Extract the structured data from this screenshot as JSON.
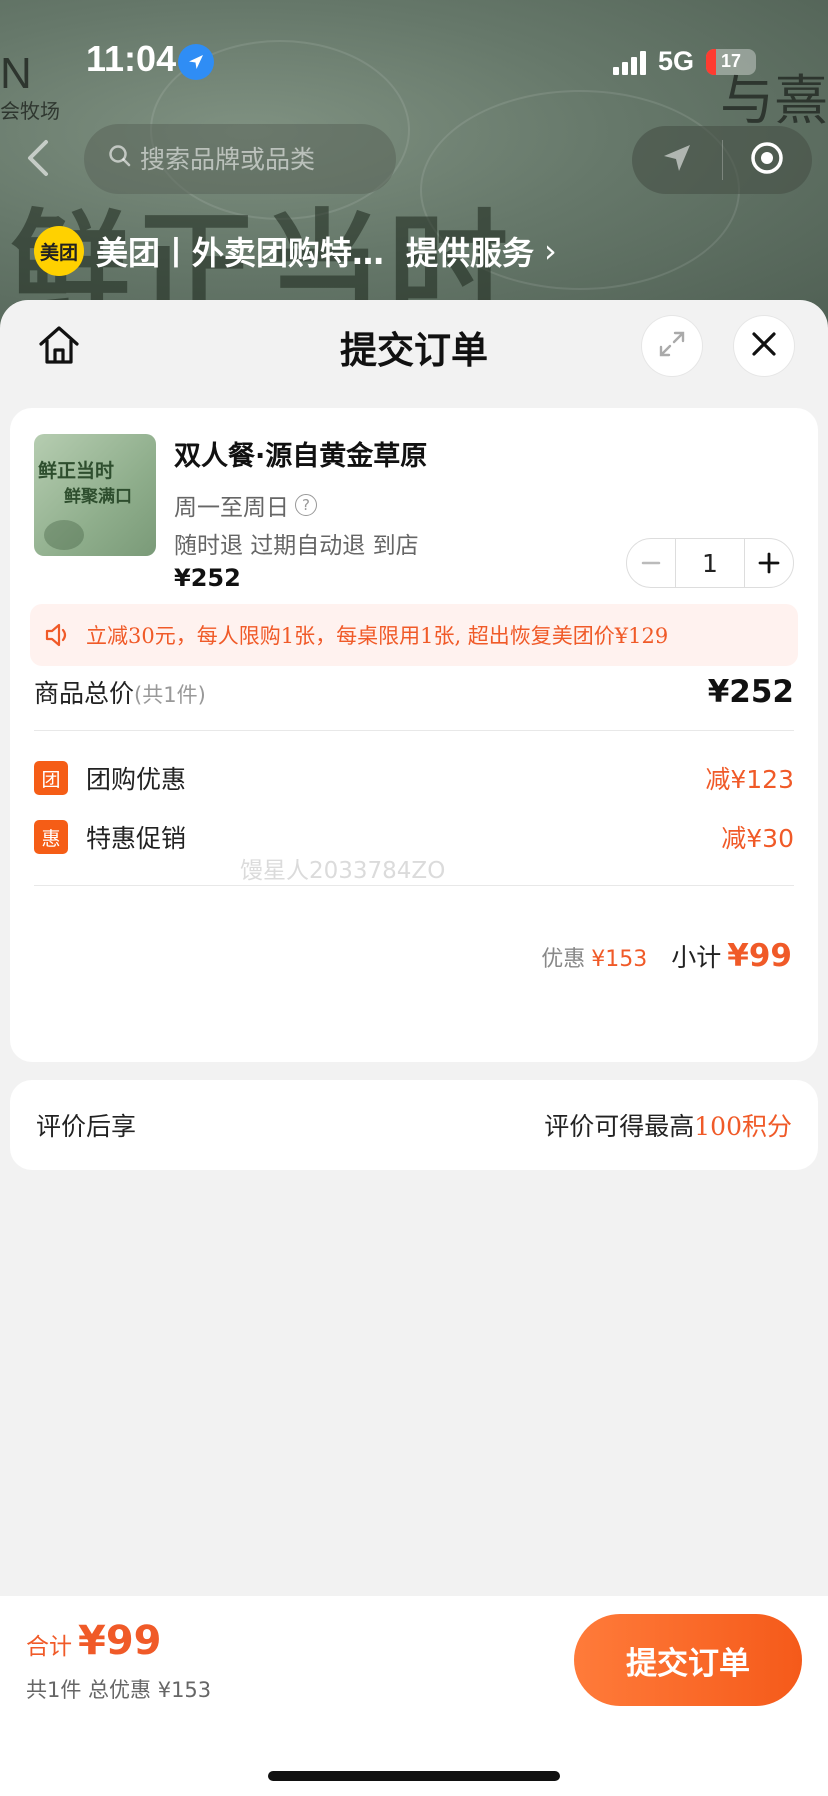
{
  "status_bar": {
    "time": "11:04",
    "network": "5G",
    "battery": "17"
  },
  "hero": {
    "brand_left": "N",
    "brand_left_sub": "会牧场",
    "brand_right": "与熹",
    "deco_text": "鲜正当时"
  },
  "nav": {
    "search_placeholder": "搜索品牌或品类"
  },
  "provider": {
    "logo_text": "美团",
    "name": "美团丨外卖团购特…",
    "service": "提供服务",
    "chevron": "›"
  },
  "sheet": {
    "title": "提交订单"
  },
  "product": {
    "name": "双人餐·源自黄金草原",
    "days": "周一至周日",
    "rules": "随时退 过期自动退 到店",
    "price": "¥252",
    "quantity": "1",
    "thumb_text_1": "鲜正当时",
    "thumb_text_2": "鲜聚满口"
  },
  "notice": {
    "text": "立减30元，每人限购1张，每桌限用1张, 超出恢复美团价¥129"
  },
  "totals": {
    "goods_label": "商品总价",
    "goods_count": "(共1件)",
    "goods_amount": "¥252",
    "discounts": [
      {
        "tag": "团",
        "label": "团购优惠",
        "amount": "减¥123"
      },
      {
        "tag": "惠",
        "label": "特惠促销",
        "amount": "减¥30"
      }
    ],
    "watermark": "馒星人2033784ZO",
    "discount_label": "优惠",
    "discount_amount": "¥153",
    "subtotal_label": "小计",
    "subtotal_amount": "¥99"
  },
  "review": {
    "left": "评价后享",
    "right_prefix": "评价可得最高",
    "right_points": "100积分"
  },
  "bottom": {
    "sum_label": "合计",
    "sum_amount": "¥99",
    "sum_detail": "共1件 总优惠 ¥153",
    "submit": "提交订单"
  },
  "colors": {
    "accent": "#f05a28",
    "button": "#f55a1a",
    "meituan_yellow": "#ffd100"
  }
}
